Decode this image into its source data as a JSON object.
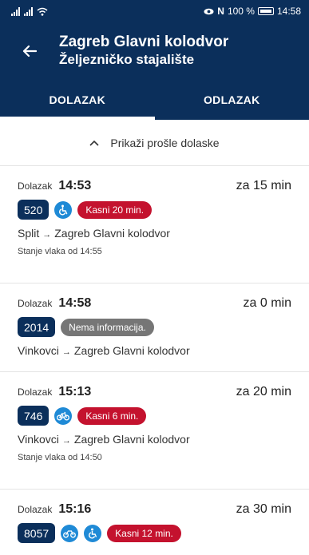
{
  "status_bar": {
    "network_icon": "wifi-icon",
    "nfc_label": "N",
    "battery_percent": "100 %",
    "time": "14:58"
  },
  "header": {
    "title": "Zagreb Glavni kolodvor",
    "subtitle": "Željezničko stajalište",
    "background": "#0b2f5b"
  },
  "tabs": [
    {
      "label": "DOLAZAK",
      "active": true
    },
    {
      "label": "ODLAZAK",
      "active": false
    }
  ],
  "show_past": {
    "label": "Prikaži prošle dolaske"
  },
  "arrivals": [
    {
      "prefix": "Dolazak",
      "time": "14:53",
      "eta": "za 15 min",
      "train": "520",
      "icon": "wheelchair-icon",
      "status": "Kasni 20 min.",
      "status_color": "#c4122e",
      "origin": "Split",
      "destination": "Zagreb Glavni kolodvor",
      "state": "Stanje vlaka od 14:55"
    },
    {
      "prefix": "Dolazak",
      "time": "14:58",
      "eta": "za 0 min",
      "train": "2014",
      "status": "Nema informacija.",
      "status_color": "#767676",
      "origin": "Vinkovci",
      "destination": "Zagreb Glavni kolodvor"
    },
    {
      "prefix": "Dolazak",
      "time": "15:13",
      "eta": "za 20 min",
      "train": "746",
      "icon": "bicycle-icon",
      "status": "Kasni 6 min.",
      "status_color": "#c4122e",
      "origin": "Vinkovci",
      "destination": "Zagreb Glavni kolodvor",
      "state": "Stanje vlaka od 14:50"
    },
    {
      "prefix": "Dolazak",
      "time": "15:16",
      "eta": "za 30 min",
      "train": "8057",
      "status": "Kasni 12 min.",
      "status_color": "#c4122e"
    }
  ]
}
